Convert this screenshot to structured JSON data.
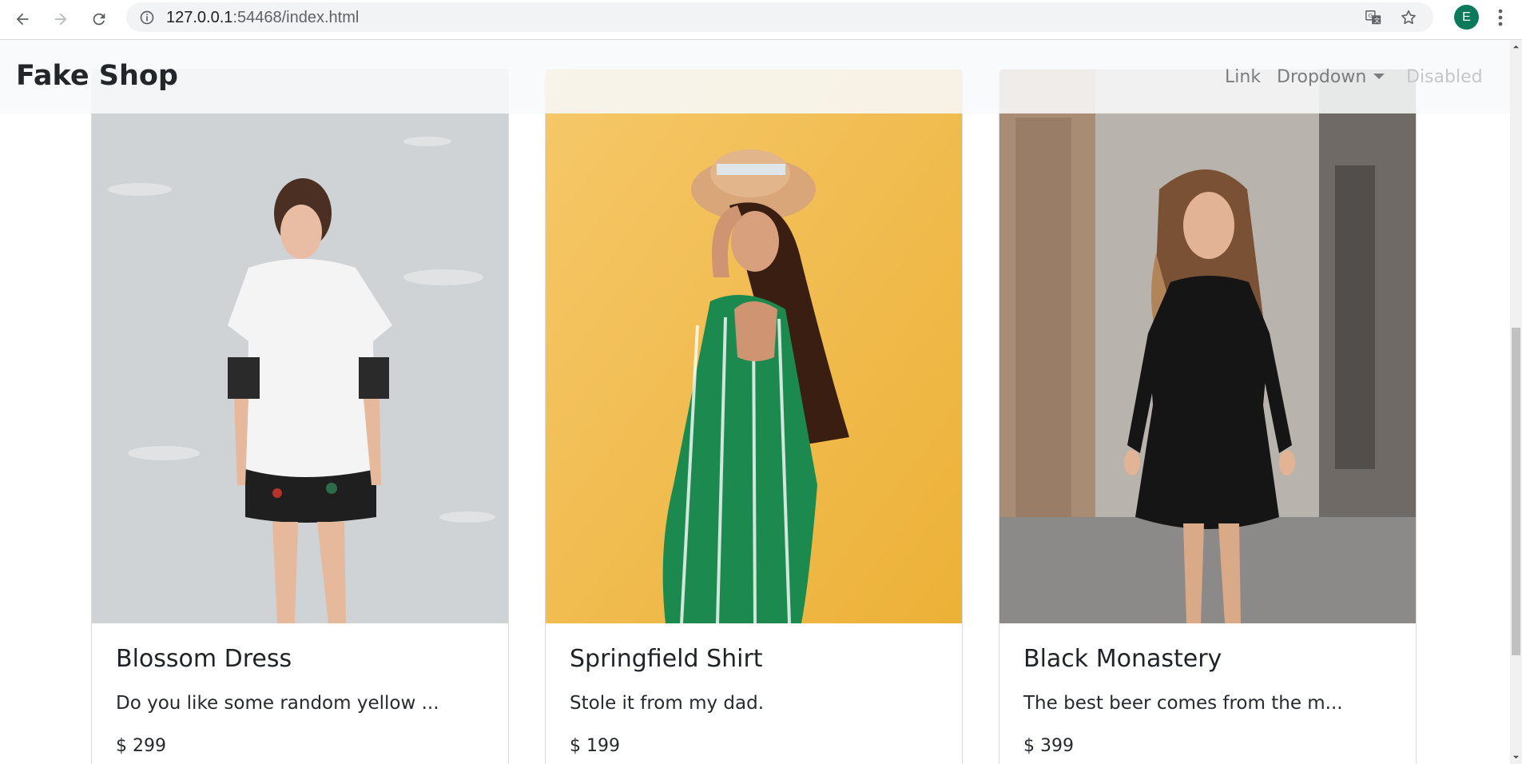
{
  "browser": {
    "url_host": "127.0.0.1",
    "url_rest": ":54468/index.html",
    "profile_initial": "E",
    "icons": [
      "back-arrow-icon",
      "forward-arrow-icon",
      "reload-icon",
      "info-icon",
      "translate-icon",
      "star-icon",
      "menu-kebab-icon"
    ]
  },
  "navbar": {
    "brand": "Fake Shop",
    "links": [
      "Link",
      "Dropdown",
      "Disabled"
    ]
  },
  "products": [
    {
      "name": "Blossom Dress",
      "description": "Do you like some random yellow ...",
      "price": "$ 299"
    },
    {
      "name": "Springfield Shirt",
      "description": "Stole it from my dad.",
      "price": "$ 199"
    },
    {
      "name": "Black Monastery",
      "description": "The best beer comes from the m...",
      "price": "$ 399"
    }
  ],
  "colors": {
    "accent_avatar": "#0b7a5c",
    "yellow_backdrop": "#f2b840",
    "grey_backdrop": "#c9cdd1"
  }
}
